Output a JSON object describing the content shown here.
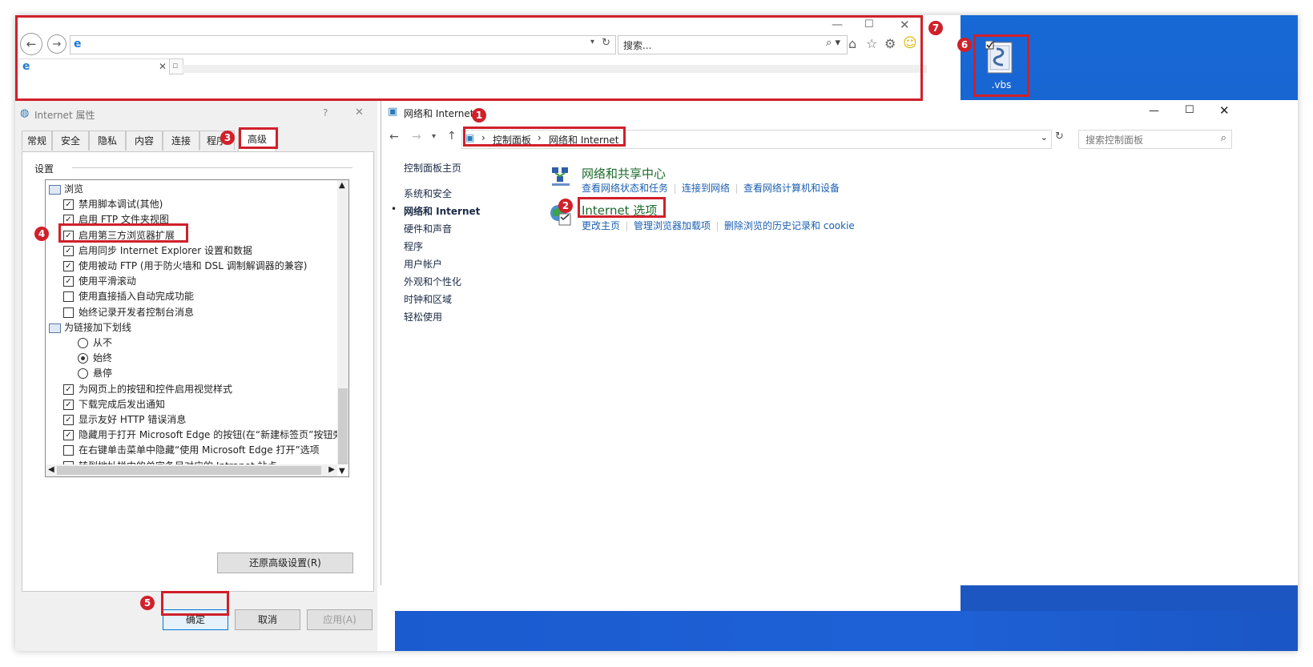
{
  "ie": {
    "search_placeholder": "搜索...",
    "buttons": [
      "back",
      "forward",
      "refresh",
      "search",
      "home",
      "favorites",
      "tools",
      "feedback"
    ]
  },
  "dialog": {
    "title": "Internet 属性",
    "help": "?",
    "close": "✕",
    "tabs": [
      "常规",
      "安全",
      "隐私",
      "内容",
      "连接",
      "程序",
      "高级"
    ],
    "active_tab": "高级",
    "settings_label": "设置",
    "items": [
      {
        "type": "folder",
        "label": "浏览"
      },
      {
        "type": "check",
        "checked": true,
        "label": "禁用脚本调试(其他)"
      },
      {
        "type": "check",
        "checked": true,
        "label": "启用 FTP 文件夹视图"
      },
      {
        "type": "check",
        "checked": true,
        "label": "启用第三方浏览器扩展"
      },
      {
        "type": "check",
        "checked": true,
        "label": "启用同步 Internet Explorer 设置和数据"
      },
      {
        "type": "check",
        "checked": true,
        "label": "使用被动 FTP (用于防火墙和 DSL 调制解调器的兼容)"
      },
      {
        "type": "check",
        "checked": true,
        "label": "使用平滑滚动"
      },
      {
        "type": "check",
        "checked": false,
        "label": "使用直接插入自动完成功能"
      },
      {
        "type": "check",
        "checked": false,
        "label": "始终记录开发者控制台消息"
      },
      {
        "type": "folder",
        "label": "为链接加下划线"
      },
      {
        "type": "radio",
        "checked": false,
        "label": "从不"
      },
      {
        "type": "radio",
        "checked": true,
        "label": "始终"
      },
      {
        "type": "radio",
        "checked": false,
        "label": "悬停"
      },
      {
        "type": "check",
        "checked": true,
        "label": "为网页上的按钮和控件启用视觉样式"
      },
      {
        "type": "check",
        "checked": true,
        "label": "下载完成后发出通知"
      },
      {
        "type": "check",
        "checked": true,
        "label": "显示友好 HTTP 错误消息"
      },
      {
        "type": "check",
        "checked": true,
        "label": "隐藏用于打开 Microsoft Edge 的按钮(在“新建标签页”按钮旁)"
      },
      {
        "type": "check",
        "checked": false,
        "label": "在右键单击菜单中隐藏“使用 Microsoft Edge 打开”选项"
      },
      {
        "type": "check",
        "checked": false,
        "label": "转到地址栏中的单字条目对应的 Intranet 站点"
      }
    ],
    "restore_button": "还原高级设置(R)",
    "ok_button": "确定",
    "cancel_button": "取消",
    "apply_button": "应用(A)"
  },
  "control_panel": {
    "title": "网络和 Internet",
    "breadcrumb": [
      "控制面板",
      "网络和 Internet"
    ],
    "search_placeholder": "搜索控制面板",
    "sidebar": [
      {
        "label": "控制面板主页",
        "active": false
      },
      {
        "label": "系统和安全",
        "active": false
      },
      {
        "label": "网络和 Internet",
        "active": true
      },
      {
        "label": "硬件和声音",
        "active": false
      },
      {
        "label": "程序",
        "active": false
      },
      {
        "label": "用户帐户",
        "active": false
      },
      {
        "label": "外观和个性化",
        "active": false
      },
      {
        "label": "时钟和区域",
        "active": false
      },
      {
        "label": "轻松使用",
        "active": false
      }
    ],
    "sections": [
      {
        "title": "网络和共享中心",
        "links": [
          "查看网络状态和任务",
          "连接到网络",
          "查看网络计算机和设备"
        ]
      },
      {
        "title": "Internet 选项",
        "links": [
          "更改主页",
          "管理浏览器加载项",
          "删除浏览的历史记录和 cookie"
        ]
      }
    ]
  },
  "desktop": {
    "file_label": ".vbs"
  },
  "annotations": [
    "1",
    "2",
    "3",
    "4",
    "5",
    "6",
    "7"
  ],
  "colors": {
    "highlight": "#d0202a",
    "link": "#1b5fb0",
    "desktop": "#1a5ec9"
  }
}
